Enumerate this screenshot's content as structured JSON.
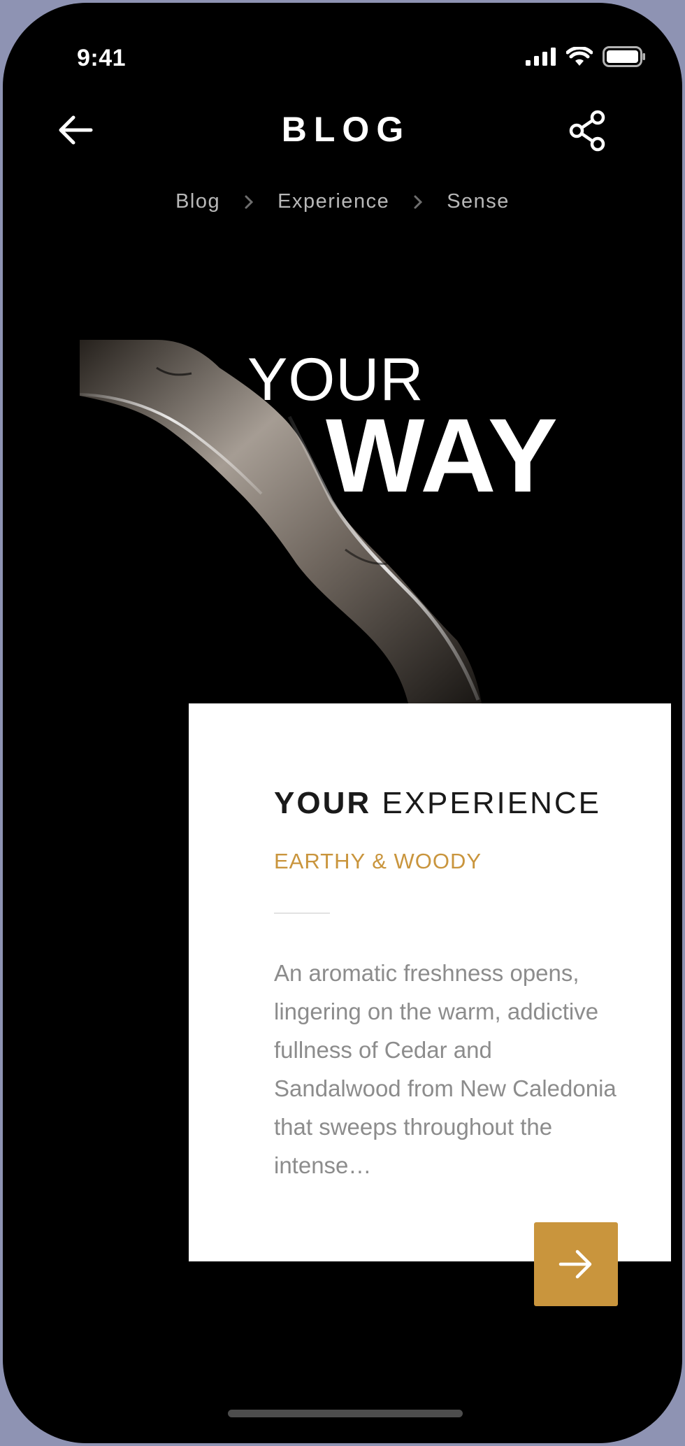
{
  "status_bar": {
    "time": "9:41"
  },
  "header": {
    "title": "BLOG",
    "back_icon": "arrow-left-icon",
    "share_icon": "share-icon"
  },
  "breadcrumb": {
    "items": [
      "Blog",
      "Experience",
      "Sense"
    ],
    "separator_icon": "chevron-right-icon"
  },
  "hero": {
    "line1": "YOUR",
    "line2": "WAY"
  },
  "card": {
    "title_bold": "YOUR",
    "title_light": "EXPERIENCE",
    "subtitle": "EARTHY & WOODY",
    "body": "An aromatic freshness opens, lingering on the warm, addictive fullness of Cedar and Sandalwood from New Caledonia that sweeps throughout the intense…",
    "next_icon": "arrow-right-icon"
  },
  "colors": {
    "accent": "#c9953d",
    "background": "#000000",
    "frame": "#8e93b3"
  }
}
